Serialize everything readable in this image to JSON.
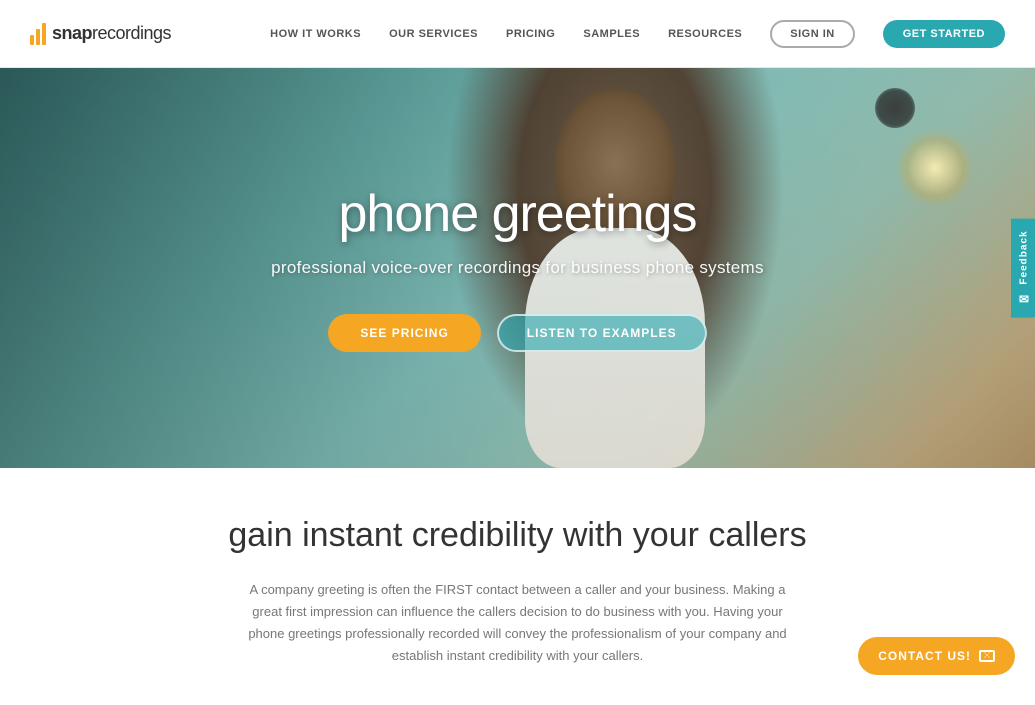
{
  "header": {
    "logo_snap": "snap",
    "logo_recordings": "recordings",
    "nav": {
      "how_it_works": "HOW IT WORKS",
      "our_services": "OUR SERVICES",
      "pricing": "PRICING",
      "samples": "SAMPLES",
      "resources": "RESOURCES",
      "sign_in": "SIGN IN",
      "get_started": "GET STARTED"
    }
  },
  "hero": {
    "title": "phone greetings",
    "subtitle": "professional voice-over recordings for business phone systems",
    "btn_pricing": "SEE PRICING",
    "btn_listen": "LISTEN TO EXAMPLES"
  },
  "feedback": {
    "label": "Feedback"
  },
  "section": {
    "title": "gain instant credibility with your callers",
    "body": "A company greeting is often the FIRST contact between a caller and your business. Making a great first impression can influence the callers decision to do business with you. Having your phone greetings professionally recorded will convey the professionalism of your company and establish instant credibility with your callers."
  },
  "contact": {
    "label": "CONTACT US!"
  },
  "colors": {
    "teal": "#2aa8b0",
    "orange": "#f5a623"
  }
}
